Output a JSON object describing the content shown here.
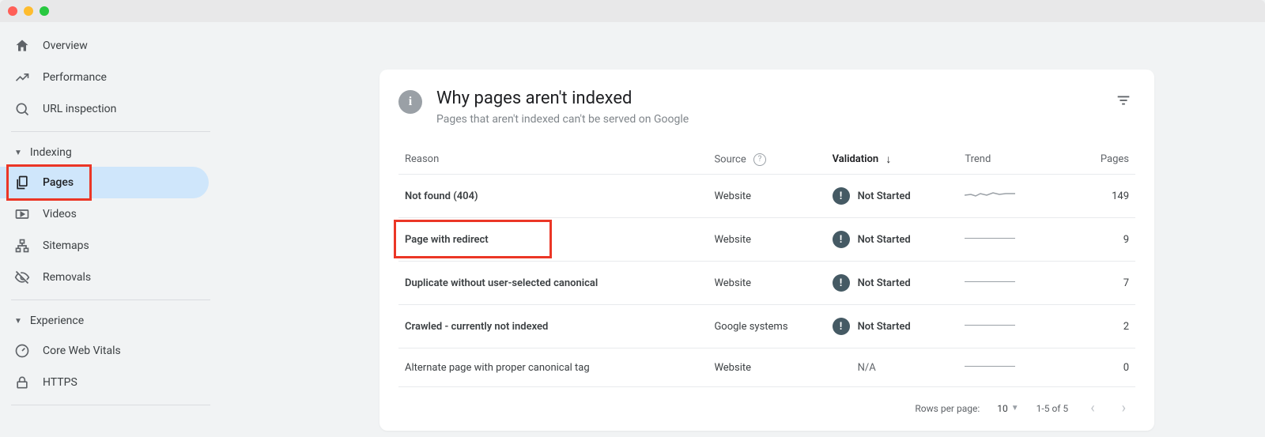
{
  "sidebar": {
    "overview": "Overview",
    "performance": "Performance",
    "url_inspection": "URL inspection",
    "section_indexing": "Indexing",
    "pages": "Pages",
    "videos": "Videos",
    "sitemaps": "Sitemaps",
    "removals": "Removals",
    "section_experience": "Experience",
    "core_web_vitals": "Core Web Vitals",
    "https": "HTTPS"
  },
  "card": {
    "title": "Why pages aren't indexed",
    "subtitle": "Pages that aren't indexed can't be served on Google"
  },
  "columns": {
    "reason": "Reason",
    "source": "Source",
    "validation": "Validation",
    "trend": "Trend",
    "pages": "Pages"
  },
  "rows": [
    {
      "reason": "Not found (404)",
      "source": "Website",
      "validation": "Not Started",
      "pages": "149",
      "trend": "wavy"
    },
    {
      "reason": "Page with redirect",
      "source": "Website",
      "validation": "Not Started",
      "pages": "9",
      "trend": "flat",
      "highlight": true
    },
    {
      "reason": "Duplicate without user-selected canonical",
      "source": "Website",
      "validation": "Not Started",
      "pages": "7",
      "trend": "flat"
    },
    {
      "reason": "Crawled - currently not indexed",
      "source": "Google systems",
      "validation": "Not Started",
      "pages": "2",
      "trend": "flat"
    },
    {
      "reason": "Alternate page with proper canonical tag",
      "source": "Website",
      "validation": "N/A",
      "pages": "0",
      "trend": "flat"
    }
  ],
  "pager": {
    "rows_label": "Rows per page:",
    "rows_value": "10",
    "range": "1-5 of 5"
  }
}
